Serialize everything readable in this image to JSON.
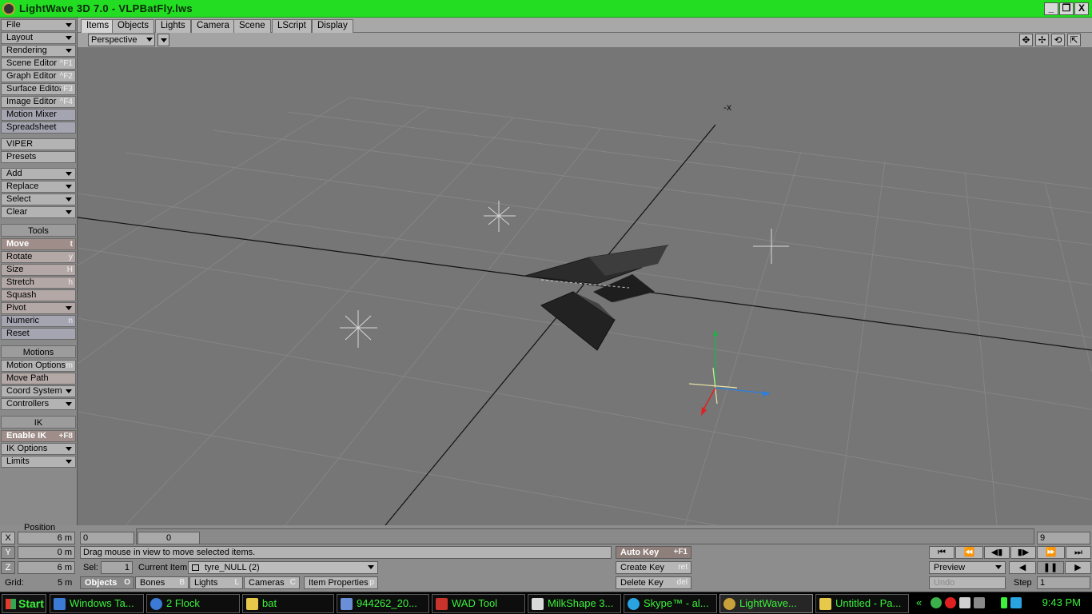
{
  "window": {
    "title": "LightWave 3D 7.0 - VLPBatFly.lws",
    "minimize": "_",
    "restore": "❐",
    "close": "X"
  },
  "tabs": [
    "Items",
    "Objects",
    "Lights",
    "Camera",
    "Scene",
    "LScript",
    "Display"
  ],
  "viewport": {
    "view_mode": "Perspective",
    "corner_label": "-x"
  },
  "sidebar": {
    "menu": [
      {
        "label": "File",
        "dd": true
      },
      {
        "label": "Layout",
        "dd": true
      },
      {
        "label": "Rendering",
        "dd": true
      },
      {
        "label": "Scene Editor",
        "sc": "^F1"
      },
      {
        "label": "Graph Editor",
        "sc": "^F2"
      },
      {
        "label": "Surface Editor",
        "sc": "^F3"
      },
      {
        "label": "Image Editor",
        "sc": "^F4"
      },
      {
        "label": "Motion Mixer"
      },
      {
        "label": "Spreadsheet"
      }
    ],
    "viper": "VIPER",
    "presets": "Presets",
    "add": "Add",
    "replace": "Replace",
    "select": "Select",
    "clear": "Clear",
    "tools_header": "Tools",
    "tools": [
      {
        "label": "Move",
        "sc": "t"
      },
      {
        "label": "Rotate",
        "sc": "y"
      },
      {
        "label": "Size",
        "sc": "H"
      },
      {
        "label": "Stretch",
        "sc": "h"
      },
      {
        "label": "Squash",
        "sc": ""
      },
      {
        "label": "Pivot",
        "dd": true
      },
      {
        "label": "Numeric",
        "sc": "n"
      },
      {
        "label": "Reset",
        "sc": ""
      }
    ],
    "motions_header": "Motions",
    "motions": [
      {
        "label": "Motion Options",
        "sc": "m"
      },
      {
        "label": "Move Path",
        "sc": ""
      },
      {
        "label": "Coord System",
        "dd": true
      },
      {
        "label": "Controllers",
        "dd": true
      }
    ],
    "ik_header": "IK",
    "ik": [
      {
        "label": "Enable IK",
        "sc": "+F8"
      },
      {
        "label": "IK Options",
        "dd": true
      },
      {
        "label": "Limits",
        "dd": true
      }
    ]
  },
  "bottom": {
    "position_label": "Position",
    "x_label": "X",
    "x_value": "6 m",
    "y_label": "Y",
    "y_value": "0 m",
    "z_label": "Z",
    "z_value": "6 m",
    "grid_label": "Grid:",
    "grid_value": "5 m",
    "frame_field": "0",
    "slider_value": "0",
    "end_frame": "9",
    "status": "Drag mouse in view to move selected items.",
    "sel_label": "Sel:",
    "sel_value": "1",
    "current_item_label": "Current Item",
    "current_item": "tyre_NULL (2)",
    "modes": [
      {
        "label": "Objects",
        "sc": "O"
      },
      {
        "label": "Bones",
        "sc": "B"
      },
      {
        "label": "Lights",
        "sc": "L"
      },
      {
        "label": "Cameras",
        "sc": "C"
      }
    ],
    "item_properties": "Item Properties",
    "item_properties_sc": "p",
    "auto_key": "Auto Key",
    "auto_key_sc": "+F1",
    "create_key": "Create Key",
    "create_key_sc": "ret",
    "delete_key": "Delete Key",
    "delete_key_sc": "del",
    "preview": "Preview",
    "undo": "Undo",
    "step_label": "Step",
    "step_value": "1"
  },
  "taskbar": {
    "start": "Start",
    "items": [
      {
        "label": "Windows Ta...",
        "color": "#3b7bd6"
      },
      {
        "label": "2 Flock",
        "color": "#3b7bd6"
      },
      {
        "label": "bat",
        "color": "#e6c84b"
      },
      {
        "label": "944262_20...",
        "color": "#6a8fd6"
      },
      {
        "label": "WAD Tool",
        "color": "#c8342b"
      },
      {
        "label": "MilkShape 3...",
        "color": "#d9d9d9"
      },
      {
        "label": "Skype™ - al...",
        "color": "#2aa4e0"
      },
      {
        "label": "LightWave...",
        "color": "#c9a13a"
      },
      {
        "label": "Untitled - Pa...",
        "color": "#e6c84b"
      }
    ],
    "chevron": "«",
    "clock": "9:43 PM"
  }
}
